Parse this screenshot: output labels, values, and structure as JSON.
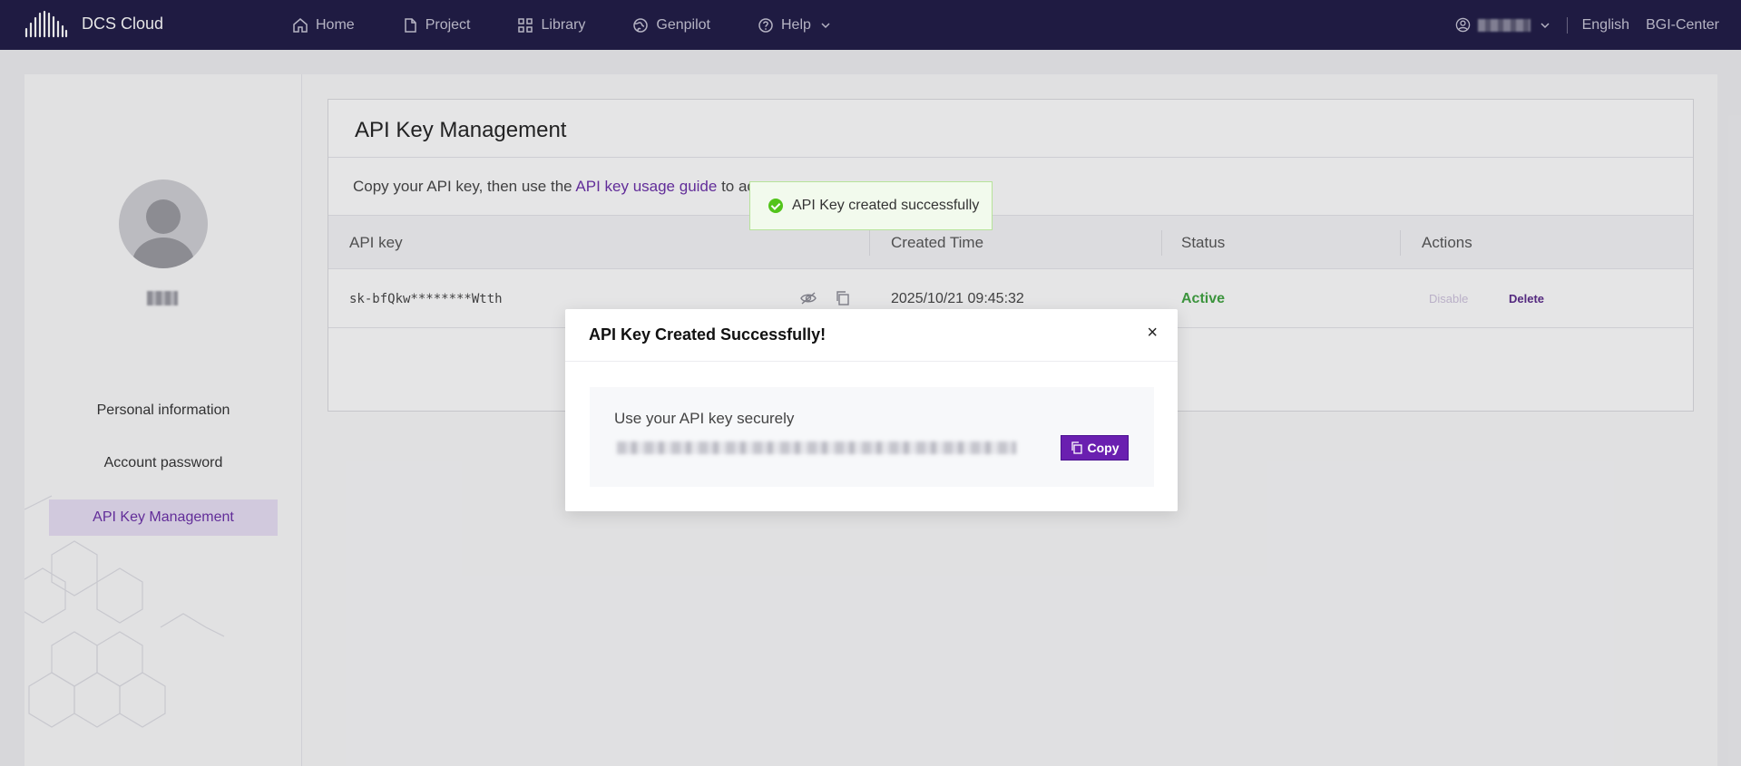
{
  "brand": {
    "name": "DCS Cloud"
  },
  "nav": {
    "items": [
      {
        "label": "Home",
        "icon": "home-icon"
      },
      {
        "label": "Project",
        "icon": "file-icon"
      },
      {
        "label": "Library",
        "icon": "grid-icon"
      },
      {
        "label": "Genpilot",
        "icon": "globe-icon"
      },
      {
        "label": "Help",
        "icon": "help-icon"
      }
    ],
    "language": "English",
    "center": "BGI-Center"
  },
  "sidebar": {
    "items": [
      {
        "label": "Personal information"
      },
      {
        "label": "Account password"
      },
      {
        "label": "API Key Management",
        "active": true
      }
    ]
  },
  "page": {
    "title": "API Key Management",
    "desc_prefix": "Copy your API key, then use the ",
    "desc_link": "API key usage guide",
    "desc_suffix": " to ac"
  },
  "table": {
    "headers": [
      "API key",
      "Created Time",
      "Status",
      "Actions"
    ],
    "rows": [
      {
        "key": "sk-bfQkw********Wtth",
        "created": "2025/10/21 09:45:32",
        "status": "Active",
        "actions": [
          "Disable",
          "Delete"
        ]
      }
    ]
  },
  "toast": {
    "message": "API Key created successfully"
  },
  "modal": {
    "title": "API Key Created Successfully!",
    "close": "×",
    "label": "Use your API key securely",
    "copy_label": "Copy"
  },
  "colors": {
    "topbar": "#1e1a45",
    "accent": "#6a1fb0",
    "active_status": "#3fa33f",
    "toast_bg": "#f2faed"
  }
}
